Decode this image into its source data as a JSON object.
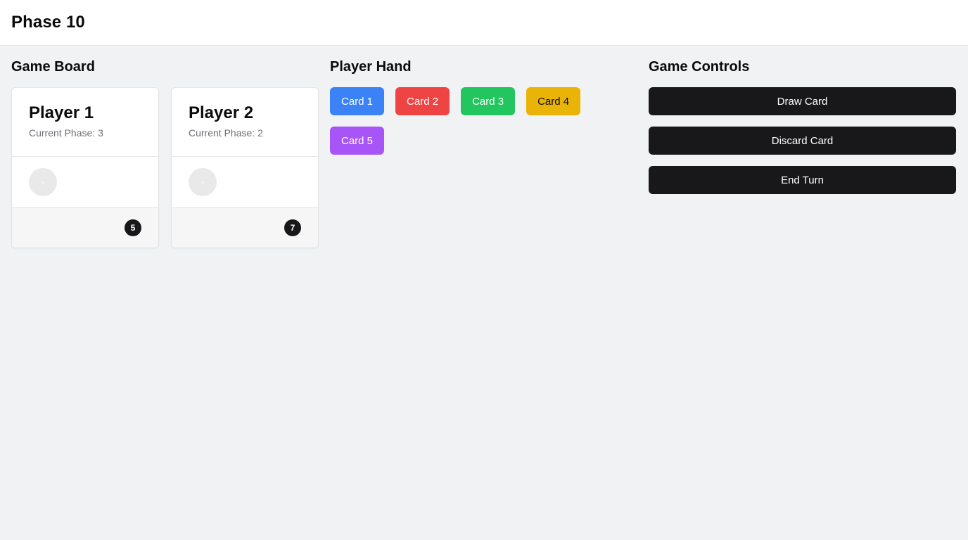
{
  "header": {
    "title": "Phase 10"
  },
  "board": {
    "title": "Game Board",
    "players": [
      {
        "name": "Player 1",
        "phase_label": "Current Phase:",
        "phase": "3",
        "card_count": "5"
      },
      {
        "name": "Player 2",
        "phase_label": "Current Phase:",
        "phase": "2",
        "card_count": "7"
      }
    ]
  },
  "hand": {
    "title": "Player Hand",
    "cards": [
      {
        "label": "Card 1",
        "color": "#3b82f6",
        "text_color": "#ffffff"
      },
      {
        "label": "Card 2",
        "color": "#ef4444",
        "text_color": "#ffffff"
      },
      {
        "label": "Card 3",
        "color": "#22c55e",
        "text_color": "#ffffff"
      },
      {
        "label": "Card 4",
        "color": "#eab308",
        "text_color": "#0b0b0c"
      },
      {
        "label": "Card 5",
        "color": "#a855f7",
        "text_color": "#ffffff"
      }
    ]
  },
  "controls": {
    "title": "Game Controls",
    "draw_label": "Draw Card",
    "discard_label": "Discard Card",
    "end_label": "End Turn"
  }
}
